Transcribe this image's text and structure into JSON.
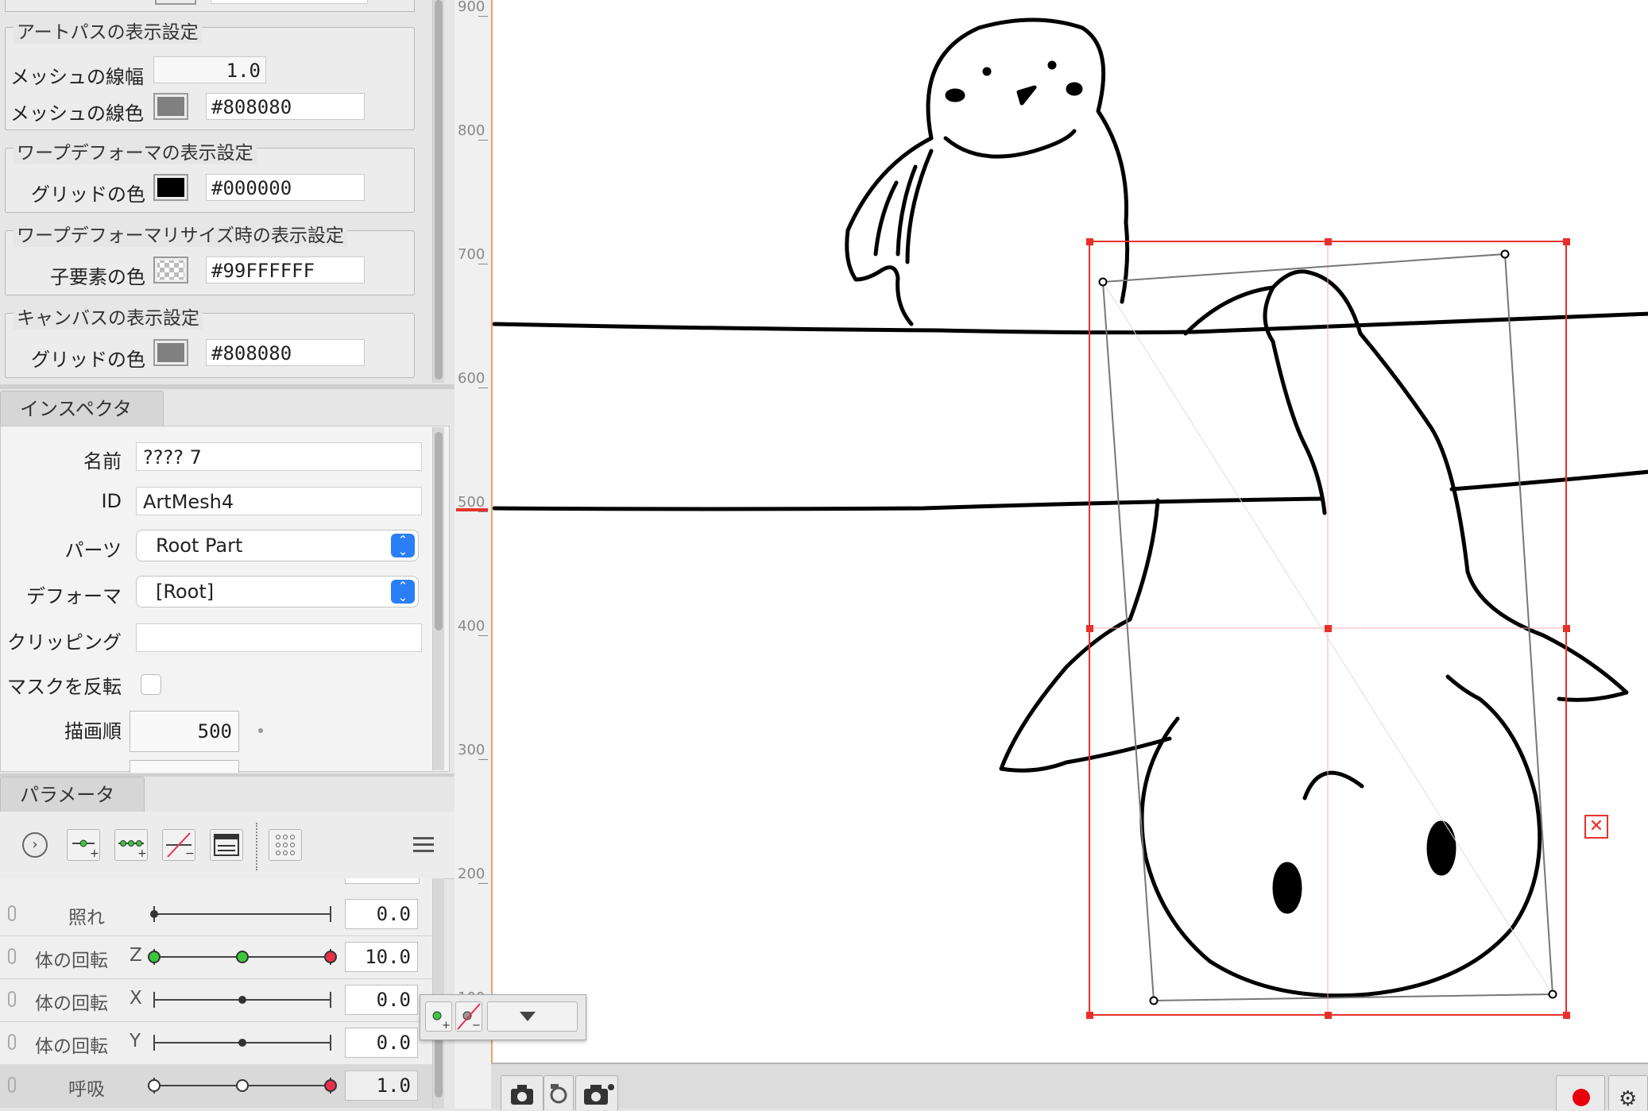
{
  "display_settings": {
    "artpath": {
      "title": "アートパスの表示設定",
      "mesh_width_label": "メッシュの線幅",
      "mesh_width_value": "1.0",
      "mesh_color_label": "メッシュの線色",
      "mesh_color_value": "#808080",
      "mesh_color_swatch": "#808080"
    },
    "warp": {
      "title": "ワープデフォーマの表示設定",
      "grid_color_label": "グリッドの色",
      "grid_color_value": "#000000",
      "grid_color_swatch": "#000000"
    },
    "warp_resize": {
      "title": "ワープデフォーマリサイズ時の表示設定",
      "child_color_label": "子要素の色",
      "child_color_value": "#99FFFFFF"
    },
    "canvas": {
      "title": "キャンバスの表示設定",
      "grid_color_label": "グリッドの色",
      "grid_color_value": "#808080",
      "grid_color_swatch": "#808080"
    }
  },
  "inspector": {
    "tab_label": "インスペクタ",
    "name_label": "名前",
    "name_value": "???? 7",
    "id_label": "ID",
    "id_value": "ArtMesh4",
    "parts_label": "パーツ",
    "parts_value": "Root Part",
    "deformer_label": "デフォーマ",
    "deformer_value": "[Root]",
    "clipping_label": "クリッピング",
    "clipping_value": "",
    "invert_mask_label": "マスクを反転",
    "invert_mask_checked": false,
    "draw_order_label": "描画順",
    "draw_order_value": "500"
  },
  "parameters": {
    "tab_label": "パラメータ",
    "toolbar_icons": [
      "expand-arrow-icon",
      "add-key-icon",
      "add-three-keys-icon",
      "delete-key-icon",
      "parameter-window-icon",
      "key-grid-icon",
      "menu-icon"
    ],
    "rows": [
      {
        "name": "照れ",
        "axis": "",
        "value": "0.0",
        "value_fraction": 0.0,
        "keys": [],
        "selected": false
      },
      {
        "name": "体の回転",
        "axis": "Z",
        "value": "10.0",
        "value_fraction": 1.0,
        "keys": [
          0.0,
          0.5,
          1.0
        ],
        "selected": false
      },
      {
        "name": "体の回転",
        "axis": "X",
        "value": "0.0",
        "value_fraction": 0.5,
        "keys": [],
        "selected": false
      },
      {
        "name": "体の回転",
        "axis": "Y",
        "value": "0.0",
        "value_fraction": 0.5,
        "keys": [],
        "selected": false
      },
      {
        "name": "呼吸",
        "axis": "",
        "value": "1.0",
        "value_fraction": 1.0,
        "keys": [
          0.0,
          0.5,
          1.0
        ],
        "selected": true
      }
    ]
  },
  "ruler": {
    "labels": [
      "900",
      "800",
      "700",
      "600",
      "500",
      "400",
      "300",
      "200",
      "100"
    ]
  },
  "colors": {
    "selection_red": "#e8302a",
    "key_green": "#3cc83c",
    "key_red": "#e8304a",
    "accent_blue": "#2b7ef6"
  },
  "icons": {
    "close_canvas": "close-x-icon",
    "record": "record-icon",
    "camera": "camera-icon"
  }
}
